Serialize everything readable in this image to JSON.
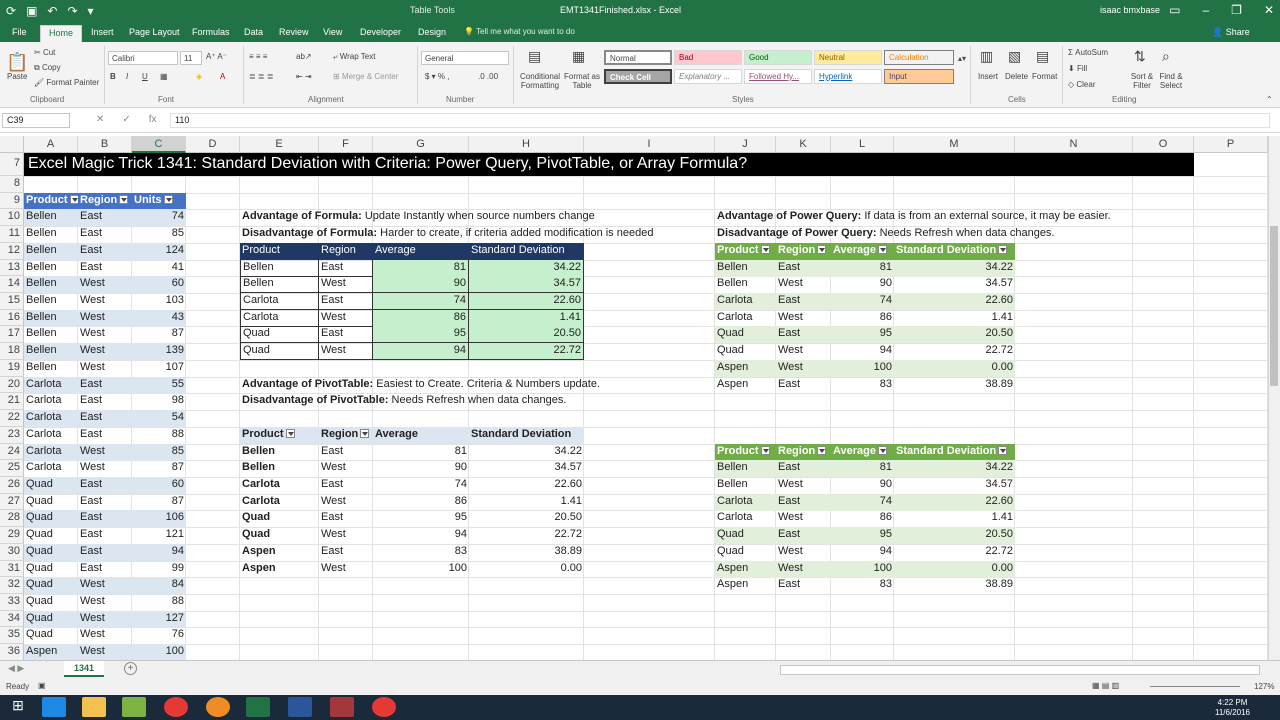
{
  "app": {
    "table_tools": "Table Tools",
    "title": "EMT1341Finished.xlsx - Excel",
    "user": "isaac bmxbase",
    "share": "Share"
  },
  "tabs": [
    "File",
    "Home",
    "Insert",
    "Page Layout",
    "Formulas",
    "Data",
    "Review",
    "View",
    "Developer",
    "Design"
  ],
  "tell_me": "Tell me what you want to do",
  "ribbon": {
    "clipboard": {
      "paste": "Paste",
      "cut": "Cut",
      "copy": "Copy",
      "format_painter": "Format Painter",
      "label": "Clipboard"
    },
    "font": {
      "name": "Calibri",
      "size": "11",
      "label": "Font"
    },
    "alignment": {
      "wrap": "Wrap Text",
      "merge": "Merge & Center",
      "label": "Alignment"
    },
    "number": {
      "format": "General",
      "label": "Number"
    },
    "styles": {
      "cond": "Conditional Formatting",
      "format_table": "Format as Table",
      "normal": "Normal",
      "bad": "Bad",
      "good": "Good",
      "neutral": "Neutral",
      "calculation": "Calculation",
      "check_cell": "Check Cell",
      "explanatory": "Explanatory ...",
      "followed": "Followed Hy...",
      "hyperlink": "Hyperlink",
      "input": "Input",
      "label": "Styles"
    },
    "cells": {
      "insert": "Insert",
      "delete": "Delete",
      "format": "Format",
      "label": "Cells"
    },
    "editing": {
      "autosum": "AutoSum",
      "fill": "Fill",
      "clear": "Clear",
      "sort": "Sort & Filter",
      "find": "Find & Select",
      "label": "Editing"
    }
  },
  "formula_bar": {
    "name_box": "C39",
    "fx": "fx",
    "value": "110"
  },
  "columns": [
    "A",
    "B",
    "C",
    "D",
    "E",
    "F",
    "G",
    "H",
    "I",
    "J",
    "K",
    "L",
    "M",
    "N",
    "O",
    "P"
  ],
  "rows": [
    "7",
    "8",
    "9",
    "10",
    "11",
    "12",
    "13",
    "14",
    "15",
    "16",
    "17",
    "18",
    "19",
    "20",
    "21",
    "22",
    "23",
    "24",
    "25",
    "26",
    "27",
    "28",
    "29",
    "30",
    "31",
    "32",
    "33",
    "34",
    "35",
    "36"
  ],
  "banner": "Excel Magic Trick 1341: Standard Deviation with Criteria: Power Query, PivotTable, or Array Formula?",
  "source_table": {
    "headers": [
      "Product",
      "Region",
      "Units"
    ],
    "rows": [
      [
        "Bellen",
        "East",
        "74"
      ],
      [
        "Bellen",
        "East",
        "85"
      ],
      [
        "Bellen",
        "East",
        "124"
      ],
      [
        "Bellen",
        "East",
        "41"
      ],
      [
        "Bellen",
        "West",
        "60"
      ],
      [
        "Bellen",
        "West",
        "103"
      ],
      [
        "Bellen",
        "West",
        "43"
      ],
      [
        "Bellen",
        "West",
        "87"
      ],
      [
        "Bellen",
        "West",
        "139"
      ],
      [
        "Bellen",
        "West",
        "107"
      ],
      [
        "Carlota",
        "East",
        "55"
      ],
      [
        "Carlota",
        "East",
        "98"
      ],
      [
        "Carlota",
        "East",
        "54"
      ],
      [
        "Carlota",
        "East",
        "88"
      ],
      [
        "Carlota",
        "West",
        "85"
      ],
      [
        "Carlota",
        "West",
        "87"
      ],
      [
        "Quad",
        "East",
        "60"
      ],
      [
        "Quad",
        "East",
        "87"
      ],
      [
        "Quad",
        "East",
        "106"
      ],
      [
        "Quad",
        "East",
        "121"
      ],
      [
        "Quad",
        "East",
        "94"
      ],
      [
        "Quad",
        "East",
        "99"
      ],
      [
        "Quad",
        "West",
        "84"
      ],
      [
        "Quad",
        "West",
        "88"
      ],
      [
        "Quad",
        "West",
        "127"
      ],
      [
        "Quad",
        "West",
        "76"
      ],
      [
        "Aspen",
        "West",
        "100"
      ]
    ]
  },
  "notes": {
    "formula_adv": {
      "label": "Advantage of Formula:",
      "text": " Update Instantly when source numbers change"
    },
    "formula_dis": {
      "label": "Disadvantage of Formula:",
      "text": " Harder to create, if criteria added modification is needed"
    },
    "pivot_adv": {
      "label": "Advantage of PivotTable:",
      "text": " Easiest to Create. Criteria & Numbers update."
    },
    "pivot_dis": {
      "label": "Disadvantage of PivotTable:",
      "text": " Needs Refresh when data changes."
    },
    "pq_adv": {
      "label": "Advantage of Power Query:",
      "text": " If data is from an external source, it may be easier."
    },
    "pq_dis": {
      "label": "Disadvantage of Power Query:",
      "text": " Needs Refresh when data changes."
    }
  },
  "formula_table": {
    "headers": [
      "Product",
      "Region",
      "Average",
      "Standard Deviation"
    ],
    "rows": [
      [
        "Bellen",
        "East",
        "81",
        "34.22"
      ],
      [
        "Bellen",
        "West",
        "90",
        "34.57"
      ],
      [
        "Carlota",
        "East",
        "74",
        "22.60"
      ],
      [
        "Carlota",
        "West",
        "86",
        "1.41"
      ],
      [
        "Quad",
        "East",
        "95",
        "20.50"
      ],
      [
        "Quad",
        "West",
        "94",
        "22.72"
      ]
    ]
  },
  "pivot_table": {
    "headers": [
      "Product",
      "Region",
      "Average",
      "Standard Deviation"
    ],
    "rows": [
      [
        "Bellen",
        "East",
        "81",
        "34.22"
      ],
      [
        "Bellen",
        "West",
        "90",
        "34.57"
      ],
      [
        "Carlota",
        "East",
        "74",
        "22.60"
      ],
      [
        "Carlota",
        "West",
        "86",
        "1.41"
      ],
      [
        "Quad",
        "East",
        "95",
        "20.50"
      ],
      [
        "Quad",
        "West",
        "94",
        "22.72"
      ],
      [
        "Aspen",
        "East",
        "83",
        "38.89"
      ],
      [
        "Aspen",
        "West",
        "100",
        "0.00"
      ]
    ]
  },
  "pq_table1": {
    "headers": [
      "Product",
      "Region",
      "Average",
      "Standard Deviation"
    ],
    "rows": [
      [
        "Bellen",
        "East",
        "81",
        "34.22"
      ],
      [
        "Bellen",
        "West",
        "90",
        "34.57"
      ],
      [
        "Carlota",
        "East",
        "74",
        "22.60"
      ],
      [
        "Carlota",
        "West",
        "86",
        "1.41"
      ],
      [
        "Quad",
        "East",
        "95",
        "20.50"
      ],
      [
        "Quad",
        "West",
        "94",
        "22.72"
      ],
      [
        "Aspen",
        "West",
        "100",
        "0.00"
      ],
      [
        "Aspen",
        "East",
        "83",
        "38.89"
      ]
    ]
  },
  "pq_table2": {
    "headers": [
      "Product",
      "Region",
      "Average",
      "Standard Deviation"
    ],
    "rows": [
      [
        "Bellen",
        "East",
        "81",
        "34.22"
      ],
      [
        "Bellen",
        "West",
        "90",
        "34.57"
      ],
      [
        "Carlota",
        "East",
        "74",
        "22.60"
      ],
      [
        "Carlota",
        "West",
        "86",
        "1.41"
      ],
      [
        "Quad",
        "East",
        "95",
        "20.50"
      ],
      [
        "Quad",
        "West",
        "94",
        "22.72"
      ],
      [
        "Aspen",
        "West",
        "100",
        "0.00"
      ],
      [
        "Aspen",
        "East",
        "83",
        "38.89"
      ]
    ]
  },
  "sheet_tab": "1341",
  "status": {
    "ready": "Ready",
    "zoom": "127%"
  },
  "clock": {
    "time": "4:22 PM",
    "date": "11/6/2016"
  }
}
